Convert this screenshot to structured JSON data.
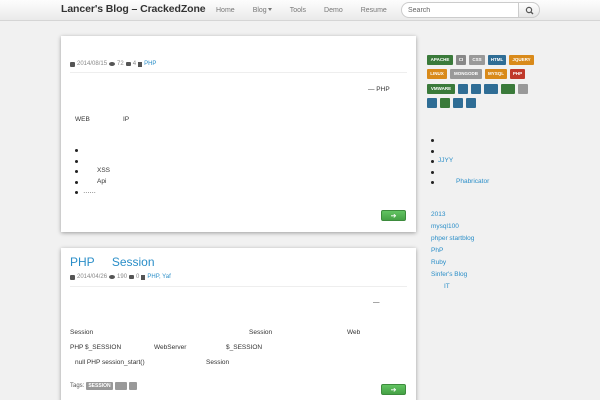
{
  "navbar": {
    "brand": "Lancer's Blog – CrackedZone",
    "links": [
      "Home",
      "Blog",
      "Tools",
      "Demo",
      "Resume"
    ],
    "search_placeholder": "Search"
  },
  "posts": [
    {
      "meta": {
        "date": "2014/08/15",
        "views": "72",
        "comments": "4",
        "category": "PHP"
      },
      "intro_text": "— PHP",
      "line_web": "WEB",
      "line_ip": "IP",
      "bullets": [
        "",
        "",
        "XSS",
        "Api",
        "……"
      ]
    },
    {
      "title_a": "PHP",
      "title_b": "Session",
      "meta": {
        "date": "2014/04/26",
        "views": "190",
        "comments": "0",
        "category": "PHP, Yaf"
      },
      "dash": "—",
      "row1": {
        "a": "Session",
        "b": "Session",
        "c": "Web"
      },
      "row2": {
        "a": "PHP  $_SESSION",
        "b": "WebServer",
        "c": "$_SESSION"
      },
      "row3": {
        "a": "null   PHP session_start()",
        "b": "Session"
      },
      "tags_label": "Tags:",
      "tags": [
        "SESSION",
        "",
        ""
      ]
    }
  ],
  "sidebar": {
    "tags": [
      {
        "label": "APACHE",
        "color": "#3a7a3a"
      },
      {
        "label": "CI",
        "color": "#888888"
      },
      {
        "label": "CSS",
        "color": "#999999"
      },
      {
        "label": "HTML",
        "color": "#2f6d95"
      },
      {
        "label": "JQUERY",
        "color": "#d98a1a"
      },
      {
        "label": "LINUX",
        "color": "#d98a1a"
      },
      {
        "label": "MONGODB",
        "color": "#999999"
      },
      {
        "label": "MYSQL",
        "color": "#d98a1a"
      },
      {
        "label": "PHP",
        "color": "#c0392b"
      },
      {
        "label": "VMWARE",
        "color": "#3a7a3a"
      },
      {
        "label": "",
        "color": "#2f6d95"
      },
      {
        "label": "",
        "color": "#2f6d95"
      },
      {
        "label": "",
        "color": "#2f6d95"
      },
      {
        "label": "",
        "color": "#3a7a3a"
      },
      {
        "label": "",
        "color": "#999999"
      },
      {
        "label": "",
        "color": "#2f6d95"
      },
      {
        "label": "",
        "color": "#3a7a3a"
      },
      {
        "label": "",
        "color": "#2f6d95"
      },
      {
        "label": "",
        "color": "#2f6d95"
      }
    ],
    "recent": [
      "",
      "",
      "JJYY",
      "",
      "Phabricator"
    ],
    "links": [
      "2013",
      "mysql100",
      "phper startblog",
      "PhP",
      "Ruby",
      "Sinfer's Blog",
      "IT"
    ]
  }
}
